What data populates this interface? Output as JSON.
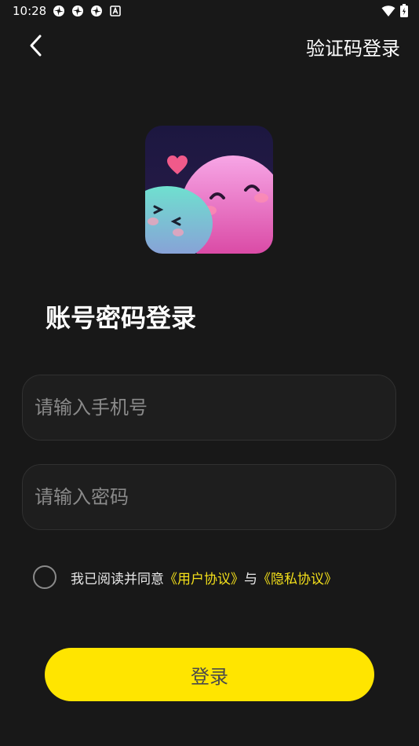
{
  "status_bar": {
    "time": "10:28",
    "notification_icons": [
      "pinwheel-icon",
      "pinwheel-icon",
      "pinwheel-icon",
      "a-box-icon"
    ],
    "wifi_icon": "wifi-icon",
    "battery_icon": "battery-icon"
  },
  "header": {
    "back_icon": "chevron-left-icon",
    "switch_label": "验证码登录"
  },
  "logo": {
    "icon": "app-logo"
  },
  "title": "账号密码登录",
  "form": {
    "phone_placeholder": "请输入手机号",
    "phone_value": "",
    "password_placeholder": "请输入密码",
    "password_value": ""
  },
  "agreement": {
    "checked": false,
    "prefix": "我已阅读并同意",
    "user_agreement": "《用户协议》",
    "conjunction": "与",
    "privacy_policy": "《隐私协议》"
  },
  "login_button_label": "登录",
  "colors": {
    "background": "#181818",
    "accent": "#ffe500",
    "link": "#f4e01a"
  }
}
